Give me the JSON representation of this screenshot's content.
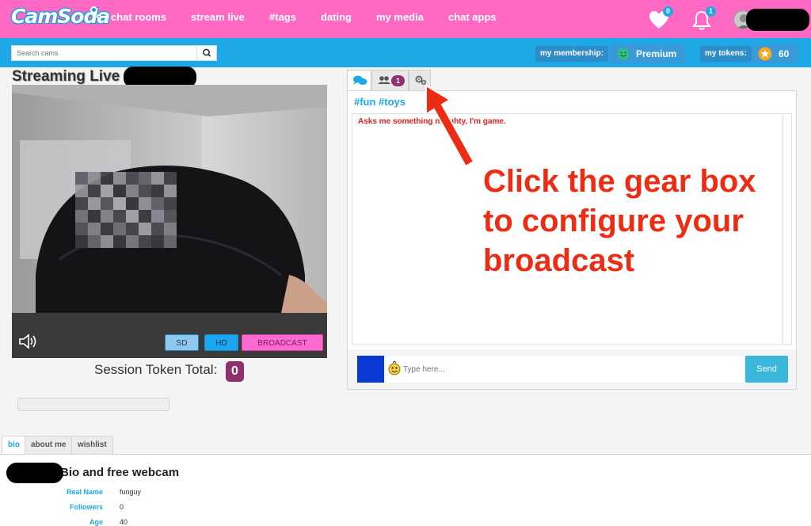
{
  "brand": {
    "logo_text": "CamSoda"
  },
  "nav": {
    "items": [
      "chat rooms",
      "stream live",
      "#tags",
      "dating",
      "my media",
      "chat apps"
    ]
  },
  "header": {
    "favorites_count": "0",
    "notifications_count": "1",
    "icons": [
      "heart-icon",
      "bell-icon",
      "avatar"
    ]
  },
  "search": {
    "placeholder": "Search cams"
  },
  "membership": {
    "label": "my membership:",
    "value": "Premium"
  },
  "tokens": {
    "label": "my tokens:",
    "value": "60"
  },
  "stream": {
    "title": "Streaming Live",
    "buttons": {
      "sd": "SD",
      "hd": "HD",
      "broadcast": "BROADCAST"
    },
    "session_label": "Session Token Total:",
    "session_value": "0"
  },
  "chat": {
    "tabs": [
      {
        "icon": "chat-icon"
      },
      {
        "icon": "users-icon",
        "count": "1"
      },
      {
        "icon": "gear-icon"
      }
    ],
    "tags": "#fun #toys",
    "message": "Asks me something naughty, I'm game.",
    "input_placeholder": "Type here...",
    "send_label": "Send"
  },
  "annotation": {
    "text": "Click the gear box to configure your broadcast"
  },
  "bio": {
    "tabs": [
      "bio",
      "about me",
      "wishlist"
    ],
    "title": "Bio and free webcam",
    "rows": [
      {
        "label": "Real Name",
        "value": "funguy"
      },
      {
        "label": "Followers",
        "value": "0"
      },
      {
        "label": "Age",
        "value": "40"
      }
    ]
  },
  "colors": {
    "brand_pink": "#ff69c4",
    "brand_blue": "#1fa8e6",
    "annotation_red": "#ec2d14",
    "token_badge": "#8f2f6e"
  }
}
